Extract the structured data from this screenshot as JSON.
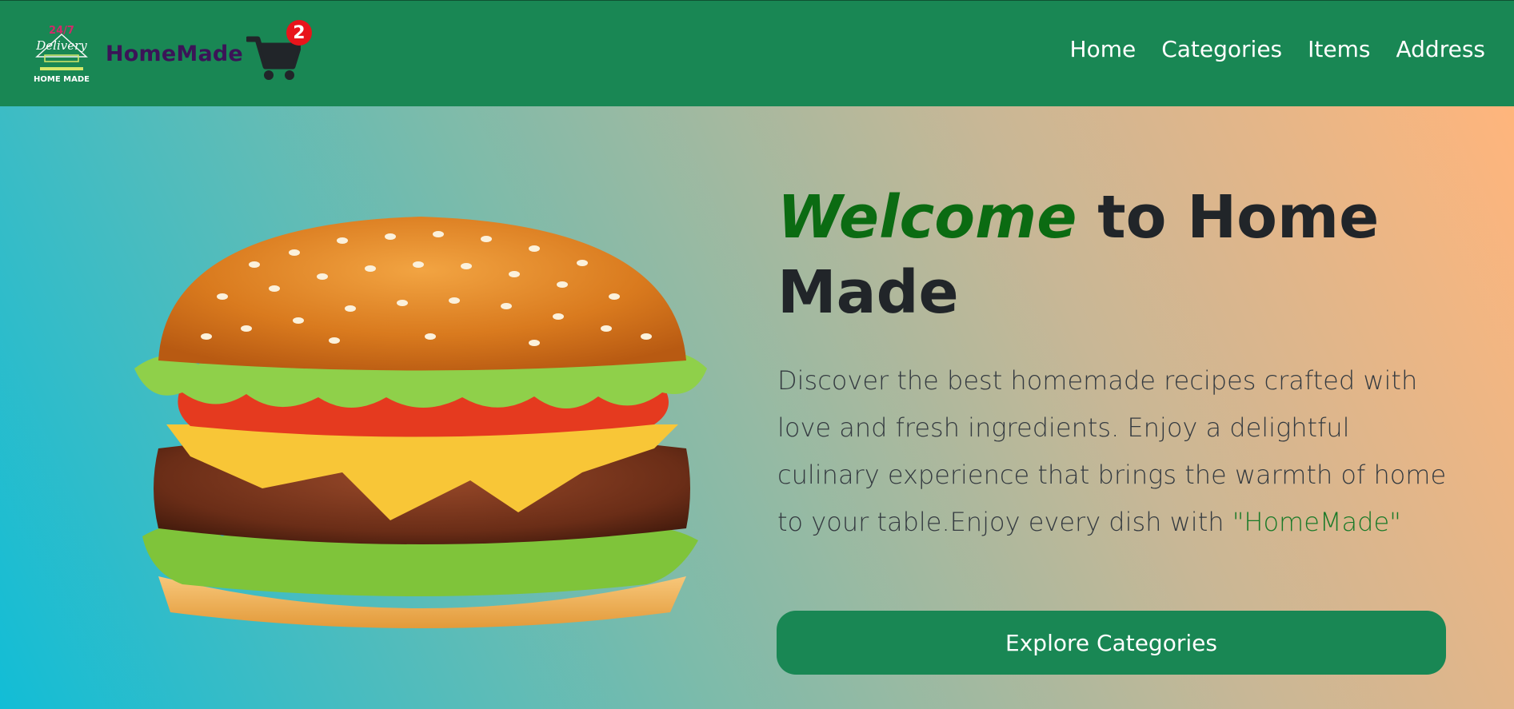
{
  "brand": {
    "name": "HomeMade",
    "logo_text_top": "24/7",
    "logo_text_mid": "Delivery",
    "logo_text_bottom": "HOME MADE"
  },
  "cart": {
    "icon": "cart-icon",
    "count": "2"
  },
  "nav": {
    "links": [
      "Home",
      "Categories",
      "Items",
      "Address"
    ]
  },
  "hero": {
    "title_accent": "Welcome",
    "title_rest": " to Home Made",
    "description": "Discover the best homemade recipes crafted with love and fresh ingredients. Enjoy a delightful culinary experience that brings the warmth of home to your table.Enjoy every dish with ",
    "description_highlight": "\"HomeMade\"",
    "cta_label": "Explore Categories",
    "image": "burger-image"
  },
  "colors": {
    "navbar": "#198754",
    "accent": "#0b6b12",
    "badge": "#e8141b",
    "brand_text": "#3b1457"
  }
}
